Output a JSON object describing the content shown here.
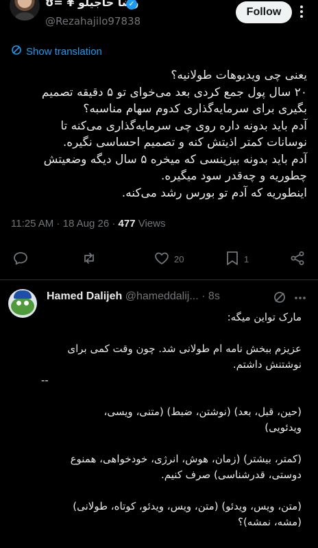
{
  "post": {
    "author_name": "رضا حاجیلو ¥ =ʊ",
    "author_handle": "@Rezahajilo97838",
    "follow_label": "Follow",
    "show_translation": "Show translation",
    "text_lines": [
      "یعنی چی ویدیوهات طولانیه؟",
      "۲۰ سال پول جمع کردی بعد می‌خوای تو ۵ دقیقه تصمیم",
      "بگیری برای سرمایه‌گذاری کدوم سهام مناسبه؟",
      "آدم باید بدونه داره روی چی سرمایه‌گذاری می‌کنه تا",
      "نوسانات کمتر اذیتش کنه و تصمیم احساسی نگیره.",
      "آدم باید بدونه بیزینسی که میخره ۵ سال دیگه وضعیتش",
      "چطوریه و چه‌قدر سود میگیره.",
      "اینطوریه که آدم تو بورس رشد می‌کنه."
    ],
    "time": "11:25 AM",
    "date": "18 Aug 26",
    "views_count": "477",
    "views_label": "Views",
    "likes": "20",
    "bookmarks": "1"
  },
  "reply": {
    "author_name": "Hamed Dalijeh",
    "author_handle": "@hameddalij...",
    "time_ago": "8s",
    "text_lines": [
      "مارک تواین میگه:",
      "",
      "عزیزم ببخش نامه ام طولانی شد. چون وقت کمی برای",
      "نوشتنش داشتم.",
      "--",
      "",
      "(حین، قبل، بعد) (نوشتن، ضبط) (متنی، ویسی،",
      "ویدئویی)",
      "",
      "(کمتر، بیشتر) (زمان، هوش، انرژی، خودخواهی، همنوع",
      "دوستی، قدرشناسی) صرف کنیم.",
      "",
      "(متن، ویس، ویدئو) (متن، ویس، ویدئو، کوتاه، طولانی)",
      "(مشه، نمشه)؟"
    ]
  },
  "colors": {
    "background": "#000000",
    "text": "#e7e9ea",
    "muted": "#71767b",
    "accent": "#1d9bf0",
    "divider": "#2f3336"
  },
  "icons": [
    "verified-badge-icon",
    "more-icon",
    "translate-icon",
    "reply-icon",
    "retweet-icon",
    "like-icon",
    "bookmark-icon",
    "share-icon",
    "mute-icon"
  ]
}
